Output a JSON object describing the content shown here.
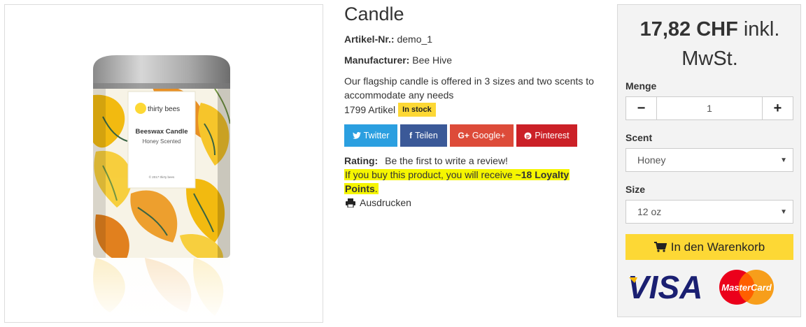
{
  "product": {
    "title": "Candle",
    "reference_label": "Artikel-Nr.:",
    "reference_value": "demo_1",
    "manufacturer_label": "Manufacturer:",
    "manufacturer_value": "Bee Hive",
    "description": "Our flagship candle is offered in 3 sizes and two scents to accommodate any needs",
    "quantity_text": "1799 Artikel",
    "stock_badge": "In stock"
  },
  "image": {
    "brand_text": "thirty bees",
    "product_name": "Beeswax Candle",
    "product_sub": "Honey Scented",
    "footer_text": "© 2017 thirty bees"
  },
  "share": {
    "twitter": {
      "icon": "twitter-bird-icon",
      "label": "Twitter"
    },
    "facebook": {
      "icon": "facebook-icon",
      "label": "Teilen"
    },
    "googleplus": {
      "icon": "googleplus-icon",
      "label": "Google+"
    },
    "pinterest": {
      "icon": "pinterest-icon",
      "label": "Pinterest"
    }
  },
  "rating": {
    "label": "Rating:",
    "text": "Be the first to write a review!"
  },
  "loyalty": {
    "prefix": "If you buy this product, you will receive ",
    "points": "~18 Loyalty Points",
    "suffix": "."
  },
  "print": {
    "icon": "printer-icon",
    "label": "Ausdrucken"
  },
  "buy": {
    "price": "17,82 CHF",
    "tax_note": "inkl. MwSt.",
    "quantity_label": "Menge",
    "quantity_value": "1",
    "decrement": "−",
    "increment": "+",
    "scent_label": "Scent",
    "scent_value": "Honey",
    "size_label": "Size",
    "size_value": "12 oz",
    "cart_label": "In den Warenkorb",
    "cart_icon": "cart-icon"
  },
  "payment": {
    "visa": "VISA",
    "mastercard": "MasterCard"
  },
  "colors": {
    "accent_yellow": "#fdd835",
    "twitter": "#2b9fe0",
    "facebook": "#3b5998",
    "googleplus": "#dd4b39",
    "pinterest": "#cb2027",
    "highlight": "#f5f500"
  }
}
